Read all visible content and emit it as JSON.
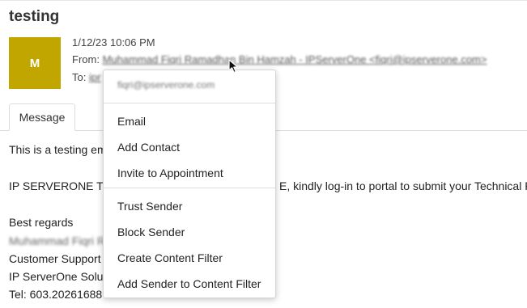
{
  "message": {
    "subject": "testing",
    "avatar_initial": "M",
    "date": "1/12/23 10:06 PM",
    "from_label": "From:",
    "from_sender": "Muhammad Fiqri Ramadhan Bin Hamzah - IPServerOne <fiqri@ipserverone.com>",
    "to_label": "To:",
    "to_value": "ipr"
  },
  "tabs": [
    {
      "label": "Message"
    }
  ],
  "body": {
    "line1": "This is a testing em",
    "line2": "IP SERVERONE T",
    "line2_right": "E, kindly log-in to portal to submit your Technical F",
    "line3": "Best regards",
    "line4": "Muhammad Fiqri R",
    "line5": "Customer Support",
    "line6": "IP ServerOne Solu",
    "line7": "Tel: 603.20261688"
  },
  "context_menu": {
    "header_email": "fiqri@ipserverone.com",
    "group1": [
      "Email",
      "Add Contact",
      "Invite to Appointment"
    ],
    "group2": [
      "Trust Sender",
      "Block Sender",
      "Create Content Filter",
      "Add Sender to Content Filter"
    ]
  },
  "icons": {
    "cursor": "mouse-pointer-icon"
  },
  "colors": {
    "avatar_bg": "#c2a600"
  }
}
